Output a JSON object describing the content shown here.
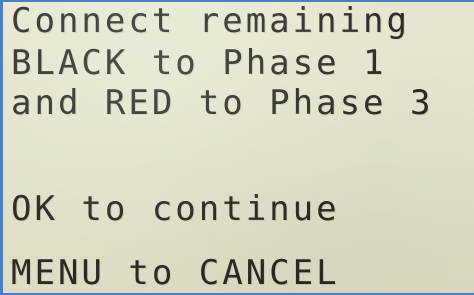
{
  "display": {
    "lines": [
      "Connect remaining",
      "BLACK to Phase 1",
      "and RED to Phase 3",
      "OK to continue",
      "MENU to CANCEL"
    ]
  }
}
